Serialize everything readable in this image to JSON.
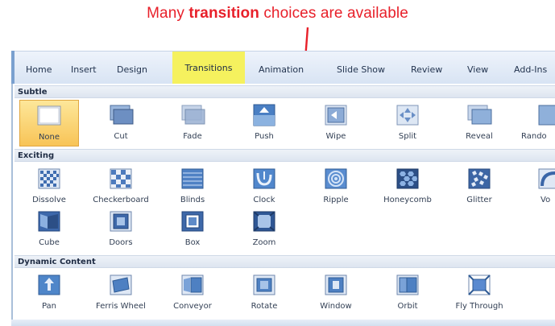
{
  "annotation": {
    "prefix": "Many ",
    "bold": "transition",
    "suffix": " choices are available",
    "color": "#e8202a"
  },
  "ribbon": {
    "tabs": [
      {
        "label": "Home"
      },
      {
        "label": "Insert"
      },
      {
        "label": "Design"
      },
      {
        "label": "Transitions",
        "active": true,
        "highlight": "#f5f15e"
      },
      {
        "label": "Animation"
      },
      {
        "label": "Slide Show"
      },
      {
        "label": "Review"
      },
      {
        "label": "View"
      },
      {
        "label": "Add-Ins"
      }
    ]
  },
  "gallery": {
    "sections": [
      {
        "title": "Subtle",
        "items": [
          {
            "label": "None",
            "icon": "none-transition-icon",
            "selected": true
          },
          {
            "label": "Cut",
            "icon": "cut-transition-icon"
          },
          {
            "label": "Fade",
            "icon": "fade-transition-icon"
          },
          {
            "label": "Push",
            "icon": "push-transition-icon"
          },
          {
            "label": "Wipe",
            "icon": "wipe-transition-icon"
          },
          {
            "label": "Split",
            "icon": "split-transition-icon"
          },
          {
            "label": "Reveal",
            "icon": "reveal-transition-icon"
          },
          {
            "label": "Rando",
            "icon": "random-bars-transition-icon"
          }
        ]
      },
      {
        "title": "Exciting",
        "items": [
          {
            "label": "Dissolve",
            "icon": "dissolve-transition-icon"
          },
          {
            "label": "Checkerboard",
            "icon": "checkerboard-transition-icon"
          },
          {
            "label": "Blinds",
            "icon": "blinds-transition-icon"
          },
          {
            "label": "Clock",
            "icon": "clock-transition-icon"
          },
          {
            "label": "Ripple",
            "icon": "ripple-transition-icon"
          },
          {
            "label": "Honeycomb",
            "icon": "honeycomb-transition-icon"
          },
          {
            "label": "Glitter",
            "icon": "glitter-transition-icon"
          },
          {
            "label": "Vo",
            "icon": "vortex-transition-icon"
          },
          {
            "label": "Cube",
            "icon": "cube-transition-icon"
          },
          {
            "label": "Doors",
            "icon": "doors-transition-icon"
          },
          {
            "label": "Box",
            "icon": "box-transition-icon"
          },
          {
            "label": "Zoom",
            "icon": "zoom-transition-icon"
          }
        ]
      },
      {
        "title": "Dynamic Content",
        "items": [
          {
            "label": "Pan",
            "icon": "pan-transition-icon"
          },
          {
            "label": "Ferris Wheel",
            "icon": "ferris-wheel-transition-icon"
          },
          {
            "label": "Conveyor",
            "icon": "conveyor-transition-icon"
          },
          {
            "label": "Rotate",
            "icon": "rotate-transition-icon"
          },
          {
            "label": "Window",
            "icon": "window-transition-icon"
          },
          {
            "label": "Orbit",
            "icon": "orbit-transition-icon"
          },
          {
            "label": "Fly Through",
            "icon": "fly-through-transition-icon"
          }
        ]
      }
    ]
  }
}
